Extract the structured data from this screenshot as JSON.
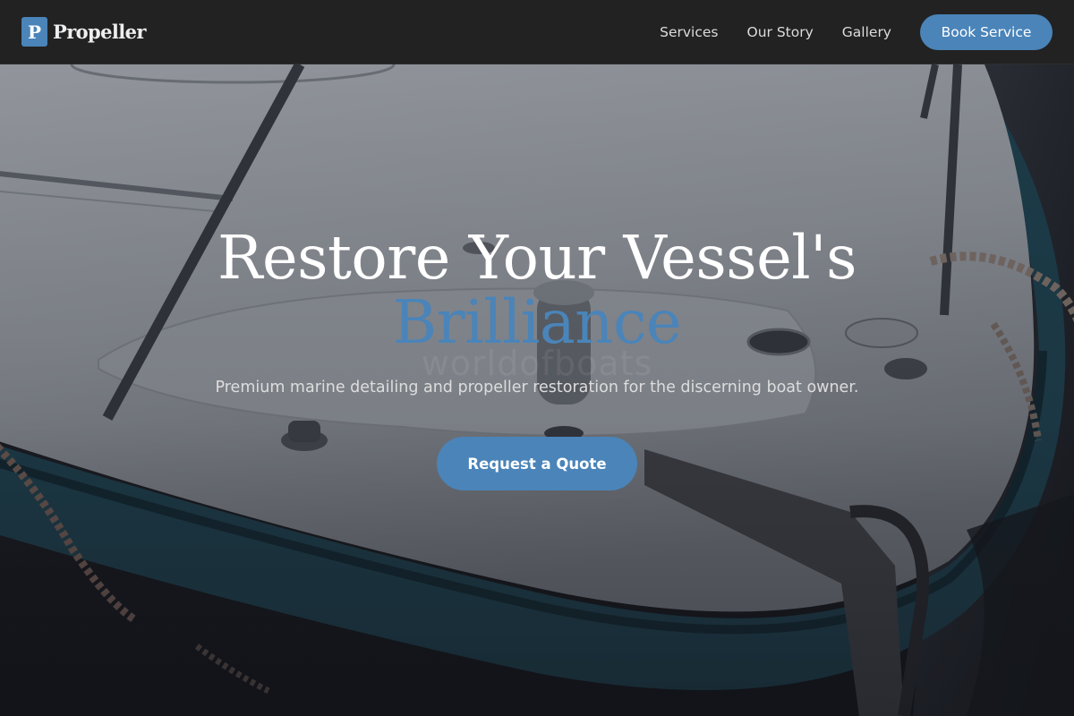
{
  "brand": {
    "mark_letter": "P",
    "name": "Propeller"
  },
  "nav": {
    "links": [
      {
        "label": "Services"
      },
      {
        "label": "Our Story"
      },
      {
        "label": "Gallery"
      }
    ],
    "cta_label": "Book Service"
  },
  "hero": {
    "title_line1": "Restore Your Vessel's",
    "title_line2": "Brilliance",
    "watermark": "worldofboats",
    "subtitle": "Premium marine detailing and propeller restoration for the discerning boat owner.",
    "cta_label": "Request a Quote"
  },
  "colors": {
    "accent": "#4a84b9",
    "navbar_bg": "#222222",
    "hero_overlay": "#16181e"
  }
}
